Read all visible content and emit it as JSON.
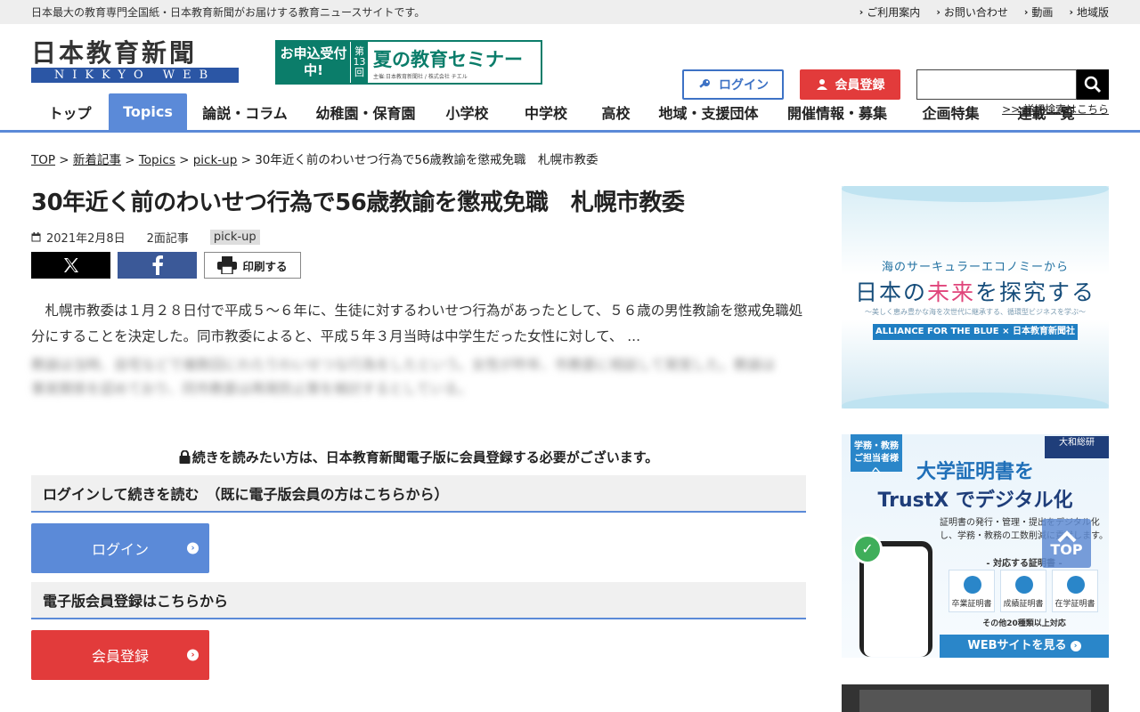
{
  "topbar": {
    "tagline": "日本最大の教育専門全国紙・日本教育新聞がお届けする教育ニュースサイトです。",
    "links": [
      "ご利用案内",
      "お問い合わせ",
      "動画",
      "地域版"
    ]
  },
  "logo": {
    "main": "日本教育新聞",
    "sub": "NIKKYO WEB"
  },
  "top_banner": {
    "left": "お申込受付中!",
    "num": "第13回",
    "title_kanji": "夏",
    "title_rest": "の教育セミナー",
    "footer": "主催:日本教育新聞社 / 株式会社 チエル"
  },
  "header": {
    "login": "ログイン",
    "register": "会員登録",
    "search_placeholder": "",
    "advanced_search": ">> 詳細検索はこちら"
  },
  "nav": {
    "items": [
      "トップ",
      "Topics",
      "論説・コラム",
      "幼稚園・保育園",
      "小学校",
      "中学校",
      "高校",
      "地域・支援団体",
      "開催情報・募集",
      "企画特集",
      "連載一覧"
    ],
    "active": "Topics"
  },
  "breadcrumb": {
    "links": [
      "TOP",
      "新着記事",
      "Topics",
      "pick-up"
    ],
    "current": "30年近く前のわいせつ行為で56歳教諭を懲戒免職　札幌市教委"
  },
  "article": {
    "title": "30年近く前のわいせつ行為で56歳教諭を懲戒免職　札幌市教委",
    "date": "2021年2月8日",
    "page": "2面記事",
    "tag": "pick-up",
    "print": "印刷する",
    "lead": "札幌市教委は１月２８日付で平成５～６年に、生徒に対するわいせつ行為があったとして、５６歳の男性教諭を懲戒免職処分にすることを決定した。同市教委によると、平成５年３月当時は中学生だった女性に対して、 ...",
    "blurred": "教諭は当時、自宅などで複数回にわたりわいせつな行為をしたという。女性が昨年、市教委に相談して発覚した。教諭は事実関係を認めており、同市教委は再発防止策を検討するとしている。"
  },
  "paywall": {
    "lock_note": "続きを読みたい方は、日本教育新聞電子版に会員登録する必要がございます。",
    "login_head": "ログインして続きを読む　（既に電子版会員の方はこちらから）",
    "login_btn": "ログイン",
    "register_head": "電子版会員登録はこちらから",
    "register_btn": "会員登録"
  },
  "sidebar": {
    "ad1": {
      "sub": "海のサーキュラーエコノミーから",
      "main_a": "日本の",
      "main_b": "未来",
      "main_c": "を探究する",
      "sub2": "～美しく恵み豊かな海を次世代に継承する、循環型ビジネスを学ぶ～",
      "bar": "ALLIANCE FOR THE BLUE × 日本教育新聞社"
    },
    "ad2": {
      "tag": "学務・教務ご担当者様へ",
      "brand": "大和総研",
      "h1": "大学証明書を",
      "h2": "TrustX でデジタル化",
      "p": "証明書の発行・管理・提出をデジタル化し、学務・教務の工数削減に貢献します。",
      "certs_title": "- 対応する証明書 -",
      "certs": [
        "卒業証明書",
        "成績証明書",
        "在学証明書"
      ],
      "other": "その他20種類以上対応",
      "btn": "WEBサイトを見る"
    }
  },
  "to_top": "TOP"
}
